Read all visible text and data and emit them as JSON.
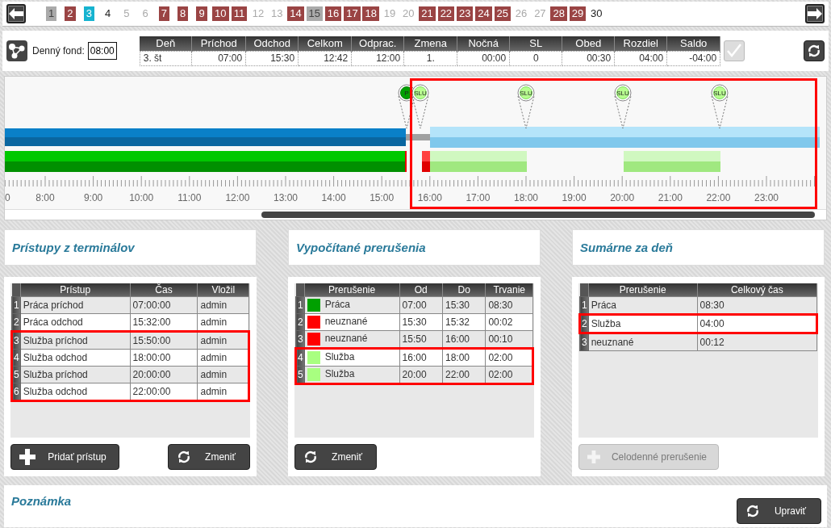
{
  "nav": {
    "days": [
      {
        "label": "1",
        "kind": "gray"
      },
      {
        "label": "2",
        "kind": "red"
      },
      {
        "label": "3",
        "kind": "current"
      },
      {
        "label": "4",
        "kind": "plain"
      },
      {
        "label": "5",
        "kind": "muted"
      },
      {
        "label": "6",
        "kind": "muted"
      },
      {
        "label": "7",
        "kind": "red"
      },
      {
        "label": "8",
        "kind": "red"
      },
      {
        "label": "9",
        "kind": "red"
      },
      {
        "label": "10",
        "kind": "red"
      },
      {
        "label": "11",
        "kind": "red"
      },
      {
        "label": "12",
        "kind": "muted"
      },
      {
        "label": "13",
        "kind": "muted"
      },
      {
        "label": "14",
        "kind": "red"
      },
      {
        "label": "15",
        "kind": "gray"
      },
      {
        "label": "16",
        "kind": "red"
      },
      {
        "label": "17",
        "kind": "red"
      },
      {
        "label": "18",
        "kind": "red"
      },
      {
        "label": "19",
        "kind": "muted"
      },
      {
        "label": "20",
        "kind": "muted"
      },
      {
        "label": "21",
        "kind": "red"
      },
      {
        "label": "22",
        "kind": "red"
      },
      {
        "label": "23",
        "kind": "red"
      },
      {
        "label": "24",
        "kind": "red"
      },
      {
        "label": "25",
        "kind": "red"
      },
      {
        "label": "26",
        "kind": "muted"
      },
      {
        "label": "27",
        "kind": "muted"
      },
      {
        "label": "28",
        "kind": "red"
      },
      {
        "label": "29",
        "kind": "red"
      },
      {
        "label": "30",
        "kind": "plain"
      }
    ]
  },
  "day_summary": {
    "fund_label": "Denný fond:",
    "fund_value": "08:00",
    "columns": [
      "Deň",
      "Príchod",
      "Odchod",
      "Celkom",
      "Odprac.",
      "Zmena",
      "Nočná",
      "SL",
      "Obed",
      "Rozdiel",
      "Saldo"
    ],
    "row": [
      "3. št",
      "07:00",
      "15:30",
      "12:42",
      "12:00",
      "1.",
      "00:00",
      "0",
      "00:30",
      "04:00",
      "-04:00"
    ],
    "confirm_disabled": true
  },
  "timeline": {
    "hours": [
      "0",
      "8:00",
      "9:00",
      "10:00",
      "11:00",
      "12:00",
      "13:00",
      "14:00",
      "15:00",
      "16:00",
      "17:00",
      "18:00",
      "19:00",
      "20:00",
      "21:00",
      "22:00",
      "23:00"
    ],
    "pins": [
      {
        "label": "P",
        "kind": "arrival"
      },
      {
        "label": "SLU",
        "kind": "service"
      },
      {
        "label": "SLU",
        "kind": "service"
      },
      {
        "label": "SLU",
        "kind": "service"
      },
      {
        "label": "SLU",
        "kind": "service"
      }
    ],
    "highlighted": true
  },
  "panels": [
    {
      "title": "Prístupy z terminálov",
      "table": {
        "columns": [
          "Prístup",
          "Čas",
          "Vložil"
        ],
        "rows": [
          {
            "index": "1",
            "cells": [
              "Práca príchod",
              "07:00:00",
              "admin"
            ],
            "highlighted": false
          },
          {
            "index": "2",
            "cells": [
              "Práca odchod",
              "15:32:00",
              "admin"
            ],
            "highlighted": false
          },
          {
            "index": "3",
            "cells": [
              "Služba príchod",
              "15:50:00",
              "admin"
            ],
            "highlighted": true
          },
          {
            "index": "4",
            "cells": [
              "Služba odchod",
              "18:00:00",
              "admin"
            ],
            "highlighted": true
          },
          {
            "index": "5",
            "cells": [
              "Služba príchod",
              "20:00:00",
              "admin"
            ],
            "highlighted": true
          },
          {
            "index": "6",
            "cells": [
              "Služba odchod",
              "22:00:00",
              "admin"
            ],
            "highlighted": true
          }
        ]
      },
      "buttons": [
        {
          "label": "Pridať prístup",
          "kind": "add",
          "disabled": false
        },
        {
          "label": "Zmeniť",
          "kind": "change",
          "disabled": false
        }
      ]
    },
    {
      "title": "Vypočítané prerušenia",
      "table": {
        "columns": [
          "Prerušenie",
          "Od",
          "Do",
          "Trvanie"
        ],
        "rows": [
          {
            "index": "1",
            "color": "#00a000",
            "cells": [
              "Práca",
              "07:00",
              "15:30",
              "08:30"
            ],
            "highlighted": false
          },
          {
            "index": "2",
            "color": "#ff0000",
            "cells": [
              "neuznané",
              "15:30",
              "15:32",
              "00:02"
            ],
            "highlighted": false
          },
          {
            "index": "3",
            "color": "#ff0000",
            "cells": [
              "neuznané",
              "15:50",
              "16:00",
              "00:10"
            ],
            "highlighted": false
          },
          {
            "index": "4",
            "color": "#a8ff80",
            "cells": [
              "Služba",
              "16:00",
              "18:00",
              "02:00"
            ],
            "highlighted": true
          },
          {
            "index": "5",
            "color": "#a8ff80",
            "cells": [
              "Služba",
              "20:00",
              "22:00",
              "02:00"
            ],
            "highlighted": true
          }
        ]
      },
      "buttons": [
        {
          "label": "Zmeniť",
          "kind": "change",
          "disabled": false
        }
      ]
    },
    {
      "title": "Sumárne za deň",
      "table": {
        "columns": [
          "Prerušenie",
          "Celkový čas"
        ],
        "rows": [
          {
            "index": "1",
            "cells": [
              "Práca",
              "08:30"
            ],
            "highlighted": false
          },
          {
            "index": "2",
            "cells": [
              "Služba",
              "04:00"
            ],
            "highlighted": true
          },
          {
            "index": "3",
            "cells": [
              "neuznané",
              "00:12"
            ],
            "highlighted": false
          }
        ]
      },
      "buttons": [
        {
          "label": "Celodenné prerušenie",
          "kind": "add",
          "disabled": true
        }
      ]
    }
  ],
  "note": {
    "title": "Poznámka",
    "button": {
      "label": "Upraviť",
      "kind": "change",
      "disabled": false
    }
  }
}
